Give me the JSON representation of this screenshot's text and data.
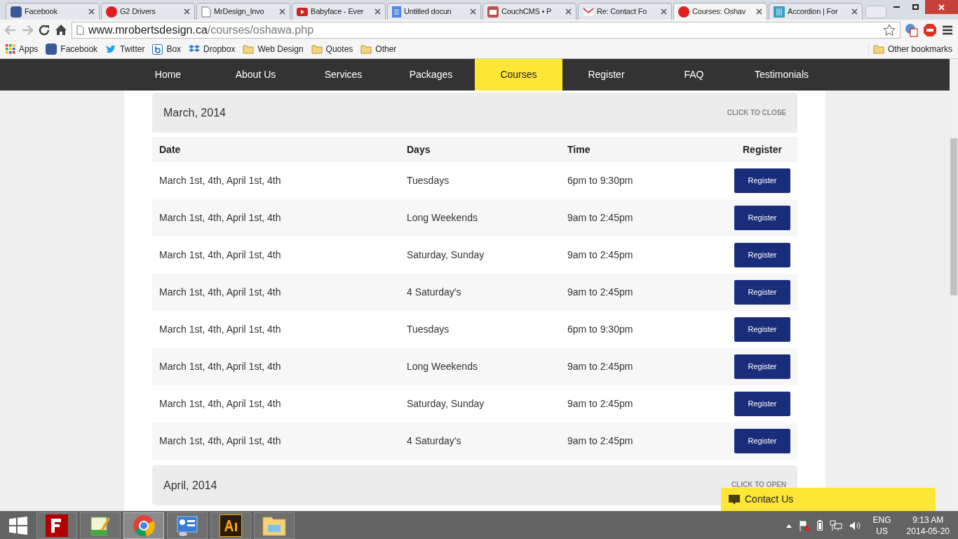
{
  "tabs": [
    {
      "title": "Facebook",
      "selected": false
    },
    {
      "title": "G2 Drivers",
      "selected": false
    },
    {
      "title": "MrDesign_Invo",
      "selected": false
    },
    {
      "title": "Babyface - Ever",
      "selected": false
    },
    {
      "title": "Untitled docun",
      "selected": false
    },
    {
      "title": "CouchCMS • P",
      "selected": false
    },
    {
      "title": "Re: Contact Fo",
      "selected": false
    },
    {
      "title": "Courses: Oshav",
      "selected": true
    },
    {
      "title": "Accordion | For",
      "selected": false
    }
  ],
  "address": {
    "domain": "www.mrobertsdesign.ca",
    "path": "/courses/oshawa.php"
  },
  "bookmarks": [
    {
      "label": "Apps"
    },
    {
      "label": "Facebook"
    },
    {
      "label": "Twitter"
    },
    {
      "label": "Box"
    },
    {
      "label": "Dropbox"
    },
    {
      "label": "Web Design"
    },
    {
      "label": "Quotes"
    },
    {
      "label": "Other"
    }
  ],
  "other_bookmarks": "Other bookmarks",
  "nav": [
    {
      "label": "Home",
      "selected": false
    },
    {
      "label": "About Us",
      "selected": false
    },
    {
      "label": "Services",
      "selected": false
    },
    {
      "label": "Packages",
      "selected": false
    },
    {
      "label": "Courses",
      "selected": true
    },
    {
      "label": "Register",
      "selected": false
    },
    {
      "label": "FAQ",
      "selected": false
    },
    {
      "label": "Testimonials",
      "selected": false
    }
  ],
  "sections": [
    {
      "title": "March, 2014",
      "action": "CLICK TO CLOSE",
      "expanded": true,
      "columns": [
        "Date",
        "Days",
        "Time",
        "Register"
      ],
      "rows": [
        {
          "date": "March 1st, 4th, April 1st, 4th",
          "days": "Tuesdays",
          "time": "6pm to 9:30pm",
          "button": "Register"
        },
        {
          "date": "March 1st, 4th, April 1st, 4th",
          "days": "Long Weekends",
          "time": "9am to 2:45pm",
          "button": "Register"
        },
        {
          "date": "March 1st, 4th, April 1st, 4th",
          "days": "Saturday, Sunday",
          "time": "9am to 2:45pm",
          "button": "Register"
        },
        {
          "date": "March 1st, 4th, April 1st, 4th",
          "days": "4 Saturday's",
          "time": "9am to 2:45pm",
          "button": "Register"
        },
        {
          "date": "March 1st, 4th, April 1st, 4th",
          "days": "Tuesdays",
          "time": "6pm to 9:30pm",
          "button": "Register"
        },
        {
          "date": "March 1st, 4th, April 1st, 4th",
          "days": "Long Weekends",
          "time": "9am to 2:45pm",
          "button": "Register"
        },
        {
          "date": "March 1st, 4th, April 1st, 4th",
          "days": "Saturday, Sunday",
          "time": "9am to 2:45pm",
          "button": "Register"
        },
        {
          "date": "March 1st, 4th, April 1st, 4th",
          "days": "4 Saturday's",
          "time": "9am to 2:45pm",
          "button": "Register"
        }
      ]
    },
    {
      "title": "April, 2014",
      "action": "CLICK TO OPEN",
      "expanded": false
    }
  ],
  "contact": {
    "label": "Contact Us"
  },
  "taskbar": {
    "language": "ENG",
    "region": "US",
    "time": "9:13 AM",
    "date": "2014-05-20"
  }
}
